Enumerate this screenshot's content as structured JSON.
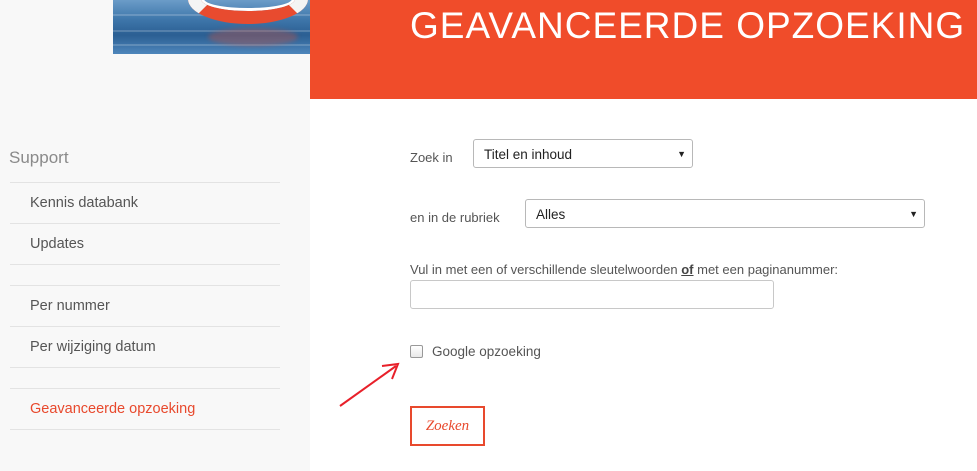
{
  "header": {
    "title": "GEAVANCEERDE OPZOEKING"
  },
  "sidebar": {
    "heading": "Support",
    "items": [
      {
        "label": "Kennis databank"
      },
      {
        "label": "Updates"
      },
      {
        "label": "Per nummer"
      },
      {
        "label": "Per wijziging datum"
      },
      {
        "label": "Geavanceerde opzoeking",
        "active": true
      }
    ]
  },
  "form": {
    "search_in_label": "Zoek in",
    "search_in_value": "Titel en inhoud",
    "category_label": "en in de rubriek",
    "category_value": "Alles",
    "keywords_label_pre": "Vul in met een of verschillende sleutelwoorden ",
    "keywords_label_or": "of",
    "keywords_label_post": " met een paginanummer:",
    "keywords_value": "",
    "google_label": "Google opzoeking",
    "google_checked": false,
    "submit_label": "Zoeken"
  },
  "colors": {
    "accent": "#f04c2a",
    "annotation": "#e8202a"
  },
  "icons": {
    "dropdown": "triangle-down-icon",
    "annotation": "red-arrow-icon",
    "banner": "lifebuoy-icon"
  }
}
